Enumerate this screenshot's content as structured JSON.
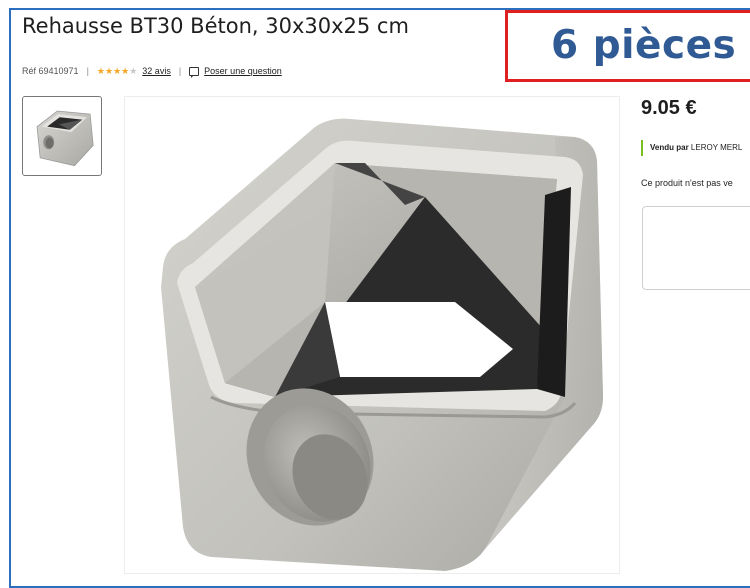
{
  "product": {
    "title": "Rehausse BT30 Béton, 30x30x25 cm",
    "reference": "Réf 69410971",
    "rating": 4,
    "rating_max": 5,
    "reviews_link": "32 avis",
    "question_link": "Poser une question",
    "price": "9.05 €",
    "seller_label": "Vendu par",
    "seller_name": "LEROY MERL",
    "availability": "Ce produit n'est pas ve"
  },
  "overlay": {
    "text": "6  pièces"
  },
  "colors": {
    "frame": "#2c6fbf",
    "overlay_border": "#e02020",
    "overlay_text": "#2f5a93",
    "star_filled": "#f5a623",
    "star_empty": "#c8c8c8",
    "seller_accent": "#78be20"
  },
  "icons": {
    "question": "question-bubble-icon",
    "star": "star-icon"
  }
}
